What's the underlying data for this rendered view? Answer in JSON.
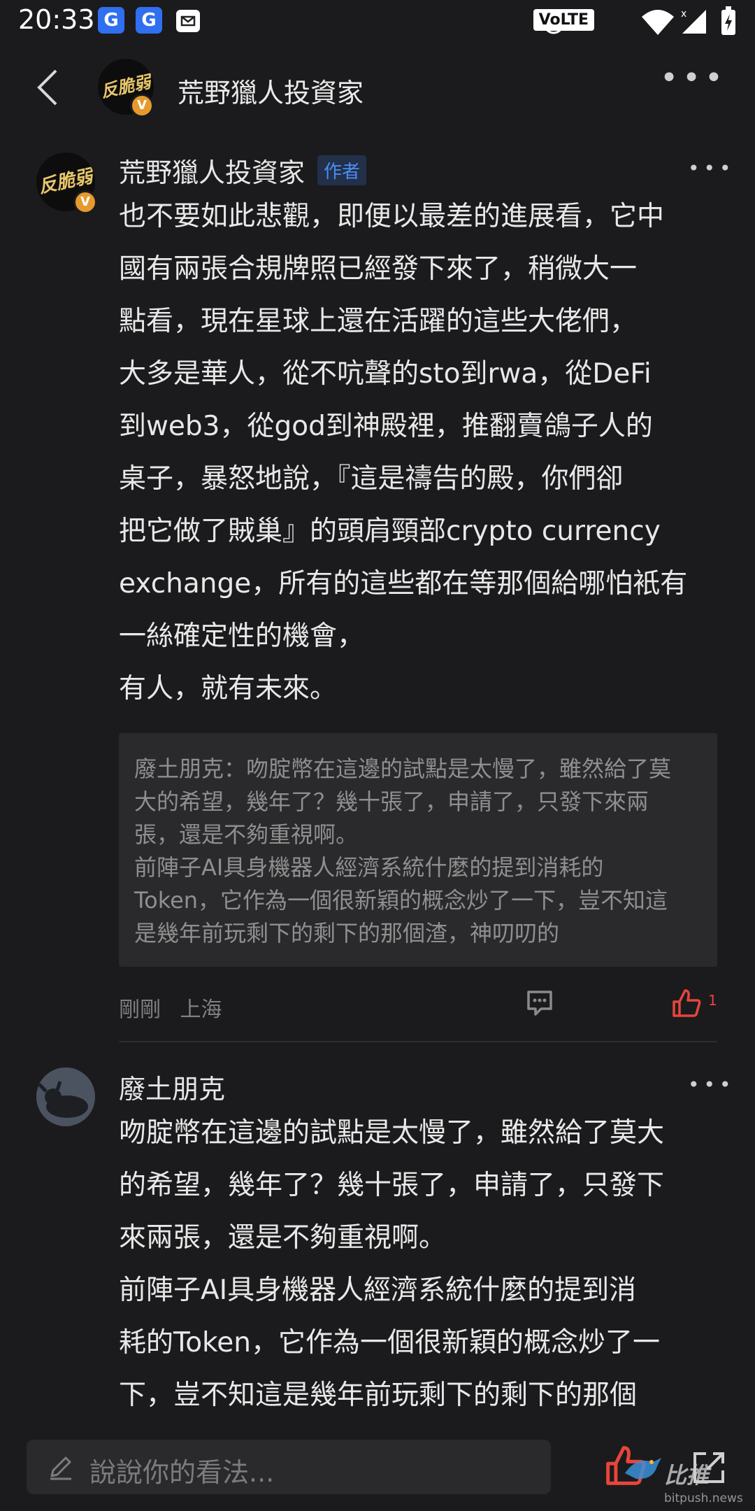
{
  "status_bar": {
    "time": "20:33",
    "volte": "VoLTE",
    "icons": [
      "app-g-icon",
      "app-g-icon",
      "mail-icon",
      "alarm-icon",
      "wifi-icon",
      "signal-icon",
      "battery-charging-icon"
    ]
  },
  "header": {
    "title": "荒野獵人投資家",
    "avatar_text": "反脆弱",
    "badge": "V"
  },
  "comments": [
    {
      "author": "荒野獵人投資家",
      "badge": "作者",
      "avatar_text": "反脆弱",
      "verified": "V",
      "body": "也不要如此悲觀，即便以最差的進展看，它中\n國有兩張合規牌照已經發下來了，稍微大一\n點看，現在星球上還在活躍的這些大佬們，\n大多是華人，從不吭聲的sto到rwa，從DeFi\n到web3，從god到神殿裡，推翻賣鴿子人的\n桌子，暴怒地說，『這是禱告的殿，你們卻\n把它做了賊巢』的頭肩頸部crypto currency\nexchange，所有的這些都在等那個給哪怕衹有\n一絲確定性的機會，\n有人，就有未來。",
      "quote": "廢土朋克：吻腚幣在這邊的試點是太慢了，雖然給了莫\n大的希望，幾年了？幾十張了，申請了，只發下來兩\n張，還是不夠重視啊。\n前陣子AI具身機器人經濟系統什麼的提到消耗的\nToken，它作為一個很新穎的概念炒了一下，豈不知這\n是幾年前玩剩下的剩下的那個渣，神叨叨的",
      "time": "剛剛",
      "location": "上海",
      "likes": "1",
      "like_color": "#e8453c"
    },
    {
      "author": "廢土朋克",
      "body": "吻腚幣在這邊的試點是太慢了，雖然給了莫大\n的希望，幾年了？幾十張了，申請了，只發下\n來兩張，還是不夠重視啊。\n前陣子AI具身機器人經濟系統什麼的提到消\n耗的Token，它作為一個很新穎的概念炒了一\n下，豈不知這是幾年前玩剩下的剩下的那個"
    }
  ],
  "bottom_bar": {
    "placeholder": "說說你的看法...",
    "watermark": "比推",
    "watermark_sub": "bitpush.news"
  },
  "colors": {
    "background": "#1b1b1d",
    "accent_blue": "#4d8cf2",
    "like_red": "#e8453c",
    "verified_orange": "#e69a2e"
  }
}
